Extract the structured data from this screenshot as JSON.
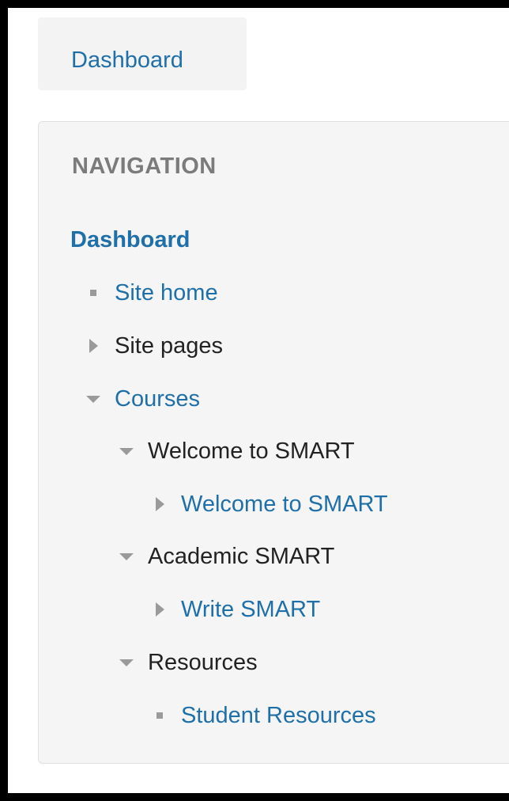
{
  "breadcrumb": {
    "label": "Dashboard"
  },
  "navigation": {
    "title": "NAVIGATION",
    "root": "Dashboard",
    "items": [
      {
        "label": "Site home",
        "icon": "bullet-icon"
      },
      {
        "label": "Site pages",
        "icon": "triangle-right-icon"
      },
      {
        "label": "Courses",
        "icon": "triangle-down-icon"
      },
      {
        "label": "Welcome to SMART",
        "icon": "triangle-down-icon"
      },
      {
        "label": "Welcome to SMART",
        "icon": "triangle-right-icon"
      },
      {
        "label": "Academic SMART",
        "icon": "triangle-down-icon"
      },
      {
        "label": "Write SMART",
        "icon": "triangle-right-icon"
      },
      {
        "label": "Resources",
        "icon": "triangle-down-icon"
      },
      {
        "label": "Student Resources",
        "icon": "bullet-icon"
      }
    ]
  }
}
